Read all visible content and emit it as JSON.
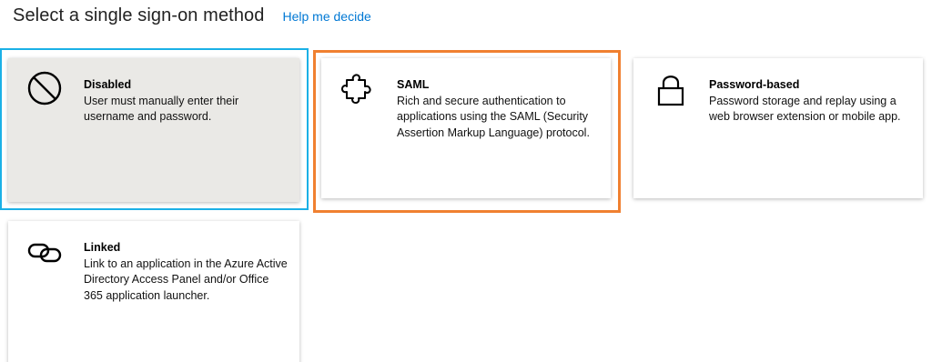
{
  "header": {
    "title": "Select a single sign-on method",
    "help_link": "Help me decide"
  },
  "methods": [
    {
      "title": "Disabled",
      "description": "User must manually enter their username and password.",
      "icon": "prohibited-icon",
      "selected": true
    },
    {
      "title": "SAML",
      "description": "Rich and secure authentication to applications using the SAML (Security Assertion Markup Language) protocol.",
      "icon": "puzzle-piece-icon",
      "selected": false
    },
    {
      "title": "Password-based",
      "description": "Password storage and replay using a web browser extension or mobile app.",
      "icon": "lock-icon",
      "selected": false
    },
    {
      "title": "Linked",
      "description": "Link to an application in the Azure Active Directory Access Panel and/or Office 365 application launcher.",
      "icon": "link-icon",
      "selected": false
    }
  ],
  "colors": {
    "selected_outline": "#1bb0e6",
    "highlight_outline": "#f08030",
    "selected_background": "#eae9e6",
    "link": "#0078d4"
  }
}
